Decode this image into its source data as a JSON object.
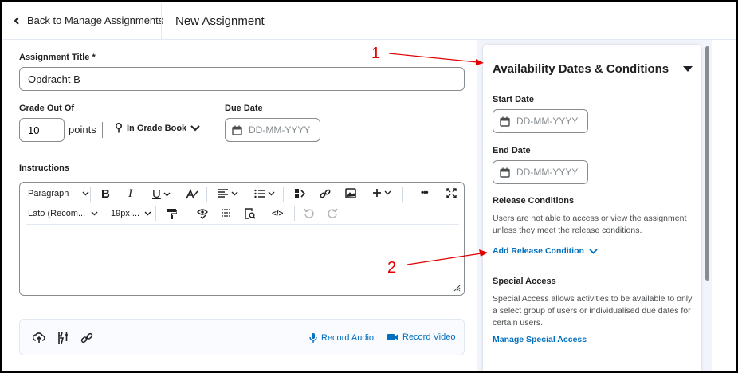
{
  "header": {
    "back_label": "Back to Manage Assignments",
    "page_title": "New Assignment"
  },
  "form": {
    "title_label": "Assignment Title *",
    "title_value": "Opdracht B",
    "grade_label": "Grade Out Of",
    "points_value": "10",
    "points_label": "points",
    "gradebook_label": "In Grade Book",
    "due_label": "Due Date",
    "date_placeholder": "DD-MM-YYYY",
    "instructions_label": "Instructions"
  },
  "editor": {
    "paragraph": "Paragraph",
    "font": "Lato (Recom...",
    "size": "19px ...",
    "bold": "B",
    "italic": "I",
    "underline": "U",
    "more": "•••",
    "code": "</>"
  },
  "attach": {
    "record_audio": "Record Audio",
    "record_video": "Record Video"
  },
  "panel": {
    "title": "Availability Dates & Conditions",
    "start_label": "Start Date",
    "end_label": "End Date",
    "date_placeholder": "DD-MM-YYYY",
    "release_label": "Release Conditions",
    "release_text": "Users are not able to access or view the assignment unless they meet the release conditions.",
    "add_release": "Add Release Condition",
    "special_label": "Special Access",
    "special_text": "Special Access allows activities to be available to only a select group of users or individualised due dates for certain users.",
    "manage_special": "Manage Special Access"
  },
  "annotations": {
    "callout_1": "1",
    "callout_2": "2",
    "color": "#e00000"
  },
  "colors": {
    "link": "#006fbf",
    "text": "#202122",
    "border": "#868c8f"
  }
}
